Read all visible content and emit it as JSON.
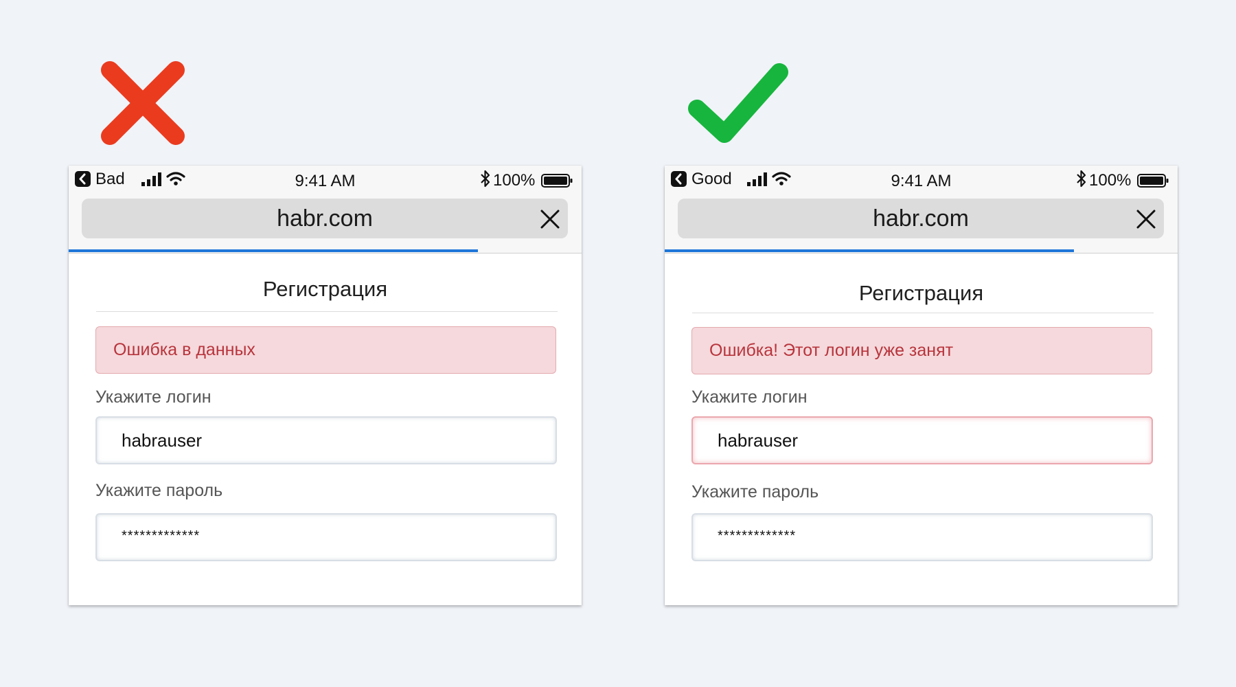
{
  "colors": {
    "bad": "#ea3b1f",
    "good": "#17b53d",
    "progress": "#1e76d8",
    "alert_text": "#b8343c"
  },
  "panels": [
    {
      "verdict_icon": "cross-icon",
      "status_bar": {
        "carrier": "Bad",
        "time": "9:41 AM",
        "battery": "100%"
      },
      "browser": {
        "url": "habr.com"
      },
      "page": {
        "title": "Регистрация",
        "error": "Ошибка в данных",
        "login_label": "Укажите логин",
        "login_value": "habrauser",
        "login_error_highlight": false,
        "password_label": "Укажите пароль",
        "password_value": "*************"
      }
    },
    {
      "verdict_icon": "checkmark-icon",
      "status_bar": {
        "carrier": "Good",
        "time": "9:41 AM",
        "battery": "100%"
      },
      "browser": {
        "url": "habr.com"
      },
      "page": {
        "title": "Регистрация",
        "error": "Ошибка! Этот логин уже занят",
        "login_label": "Укажите логин",
        "login_value": "habrauser",
        "login_error_highlight": true,
        "password_label": "Укажите пароль",
        "password_value": "*************"
      }
    }
  ]
}
